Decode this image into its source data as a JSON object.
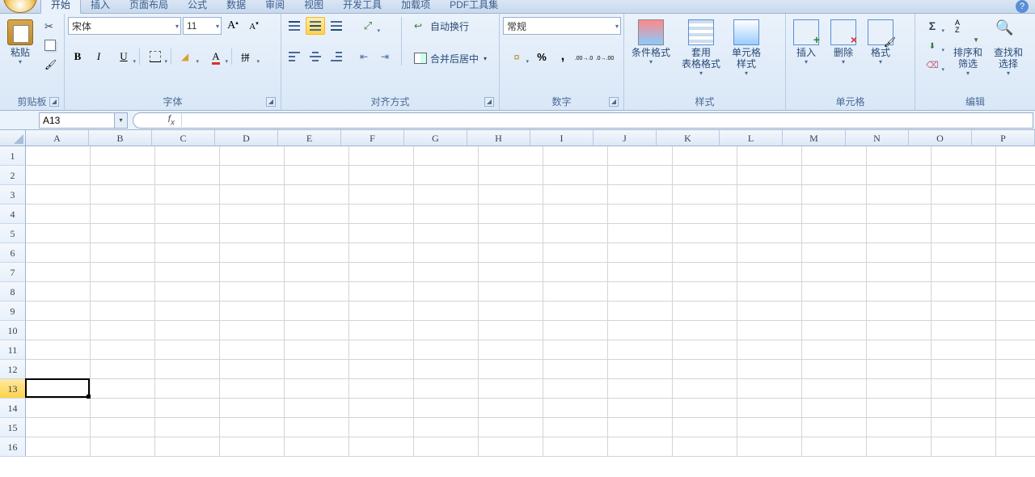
{
  "tabs": [
    "开始",
    "插入",
    "页面布局",
    "公式",
    "数据",
    "审阅",
    "视图",
    "开发工具",
    "加载项",
    "PDF工具集"
  ],
  "active_tab": 0,
  "clipboard": {
    "label": "剪贴板",
    "paste": "粘贴"
  },
  "font": {
    "label": "字体",
    "name": "宋体",
    "size": "11"
  },
  "alignment": {
    "label": "对齐方式",
    "wrap": "自动换行",
    "merge": "合并后居中"
  },
  "number": {
    "label": "数字",
    "format": "常规"
  },
  "styles": {
    "label": "样式",
    "cond": "条件格式",
    "table": "套用\n表格格式",
    "cell": "单元格\n样式"
  },
  "cells_grp": {
    "label": "单元格",
    "insert": "插入",
    "delete": "删除",
    "format": "格式"
  },
  "editing": {
    "label": "编辑",
    "sort": "排序和\n筛选",
    "find": "查找和\n选择"
  },
  "name_box": "A13",
  "formula": "",
  "columns": [
    "A",
    "B",
    "C",
    "D",
    "E",
    "F",
    "G",
    "H",
    "I",
    "J",
    "K",
    "L",
    "M",
    "N",
    "O",
    "P"
  ],
  "rows": [
    1,
    2,
    3,
    4,
    5,
    6,
    7,
    8,
    9,
    10,
    11,
    12,
    13,
    14,
    15,
    16
  ],
  "selected_row": 13,
  "active": {
    "col": 0,
    "row": 12
  }
}
